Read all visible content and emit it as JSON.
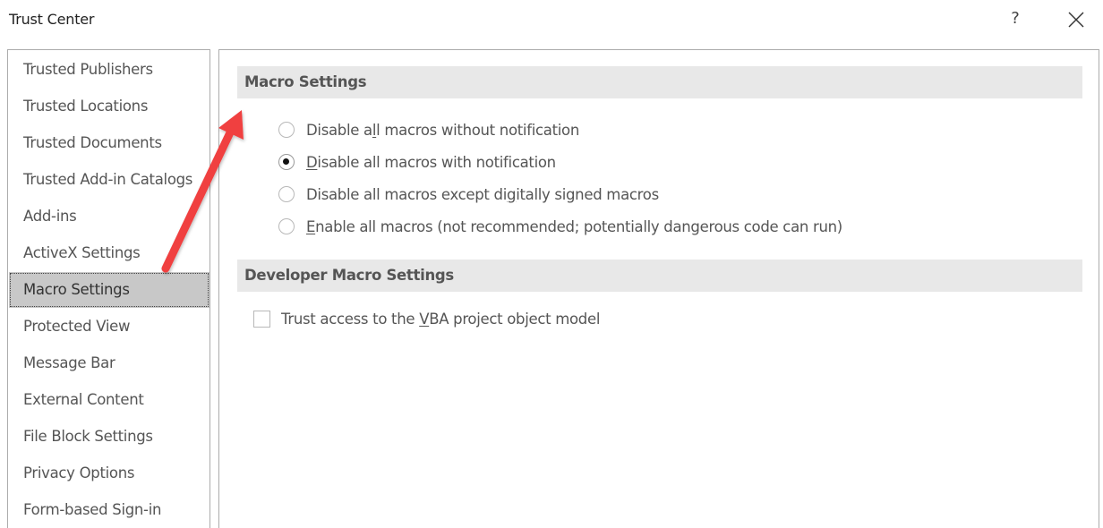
{
  "window": {
    "title": "Trust Center",
    "help_label": "?",
    "close_icon": "close-icon"
  },
  "sidebar": {
    "items": [
      {
        "label": "Trusted Publishers",
        "selected": false
      },
      {
        "label": "Trusted Locations",
        "selected": false
      },
      {
        "label": "Trusted Documents",
        "selected": false
      },
      {
        "label": "Trusted Add-in Catalogs",
        "selected": false
      },
      {
        "label": "Add-ins",
        "selected": false
      },
      {
        "label": "ActiveX Settings",
        "selected": false
      },
      {
        "label": "Macro Settings",
        "selected": true
      },
      {
        "label": "Protected View",
        "selected": false
      },
      {
        "label": "Message Bar",
        "selected": false
      },
      {
        "label": "External Content",
        "selected": false
      },
      {
        "label": "File Block Settings",
        "selected": false
      },
      {
        "label": "Privacy Options",
        "selected": false
      },
      {
        "label": "Form-based Sign-in",
        "selected": false
      }
    ]
  },
  "main": {
    "macro_settings": {
      "header": "Macro Settings",
      "options": [
        {
          "pre": "Disable a",
          "ul": "l",
          "post": "l macros without notification",
          "checked": false
        },
        {
          "pre": "",
          "ul": "D",
          "post": "isable all macros with notification",
          "checked": true
        },
        {
          "pre": "Disable all macros except di",
          "ul": "g",
          "post": "itally signed macros",
          "checked": false
        },
        {
          "pre": "",
          "ul": "E",
          "post": "nable all macros (not recommended; potentially dangerous code can run)",
          "checked": false
        }
      ]
    },
    "developer_settings": {
      "header": "Developer Macro Settings",
      "vba_access": {
        "pre": "Trust access to the ",
        "ul": "V",
        "post": "BA project object model",
        "checked": false
      }
    }
  },
  "annotation": {
    "arrow_color": "#f04040",
    "arrow_icon": "arrow-annotation-icon"
  }
}
